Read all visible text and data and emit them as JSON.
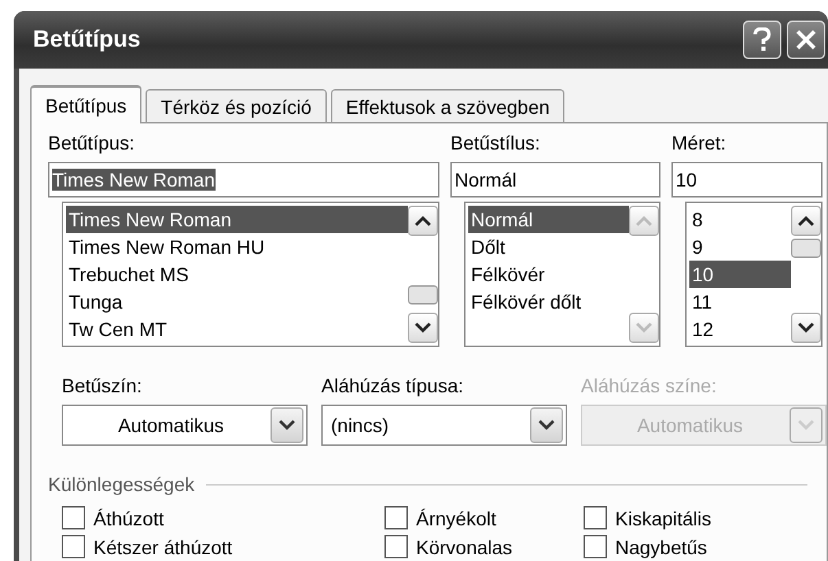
{
  "window": {
    "title": "Betűtípus"
  },
  "tabs": [
    {
      "label": "Betűtípus",
      "selected": true
    },
    {
      "label": "Térköz és pozíció",
      "selected": false
    },
    {
      "label": "Effektusok a szövegben",
      "selected": false
    }
  ],
  "font": {
    "label": "Betűtípus:",
    "value": "Times New Roman",
    "items": [
      {
        "label": "Times New Roman",
        "selected": true
      },
      {
        "label": "Times New Roman HU",
        "selected": false
      },
      {
        "label": "Trebuchet MS",
        "selected": false
      },
      {
        "label": "Tunga",
        "selected": false
      },
      {
        "label": "Tw Cen MT",
        "selected": false
      }
    ]
  },
  "style": {
    "label": "Betűstílus:",
    "value": "Normál",
    "items": [
      {
        "label": "Normál",
        "selected": true
      },
      {
        "label": "Dőlt",
        "selected": false
      },
      {
        "label": "Félkövér",
        "selected": false
      },
      {
        "label": "Félkövér dőlt",
        "selected": false
      }
    ]
  },
  "size": {
    "label": "Méret:",
    "value": "10",
    "items": [
      {
        "label": "8",
        "selected": false
      },
      {
        "label": "9",
        "selected": false
      },
      {
        "label": "10",
        "selected": true
      },
      {
        "label": "11",
        "selected": false
      },
      {
        "label": "12",
        "selected": false
      }
    ]
  },
  "dropdowns": [
    {
      "label": "Betűszín:",
      "value": "Automatikus",
      "disabled": false,
      "centered": true
    },
    {
      "label": "Aláhúzás típusa:",
      "value": "(nincs)",
      "disabled": false,
      "centered": false
    },
    {
      "label": "Aláhúzás színe:",
      "value": "Automatikus",
      "disabled": true,
      "centered": true
    }
  ],
  "effects": {
    "title": "Különlegességek",
    "columns": [
      [
        {
          "label": "Áthúzott",
          "checked": false
        },
        {
          "label": "Kétszer áthúzott",
          "checked": false
        }
      ],
      [
        {
          "label": "Árnyékolt",
          "checked": false
        },
        {
          "label": "Körvonalas",
          "checked": false
        }
      ],
      [
        {
          "label": "Kiskapitális",
          "checked": false
        },
        {
          "label": "Nagybetűs",
          "checked": false
        }
      ]
    ]
  }
}
